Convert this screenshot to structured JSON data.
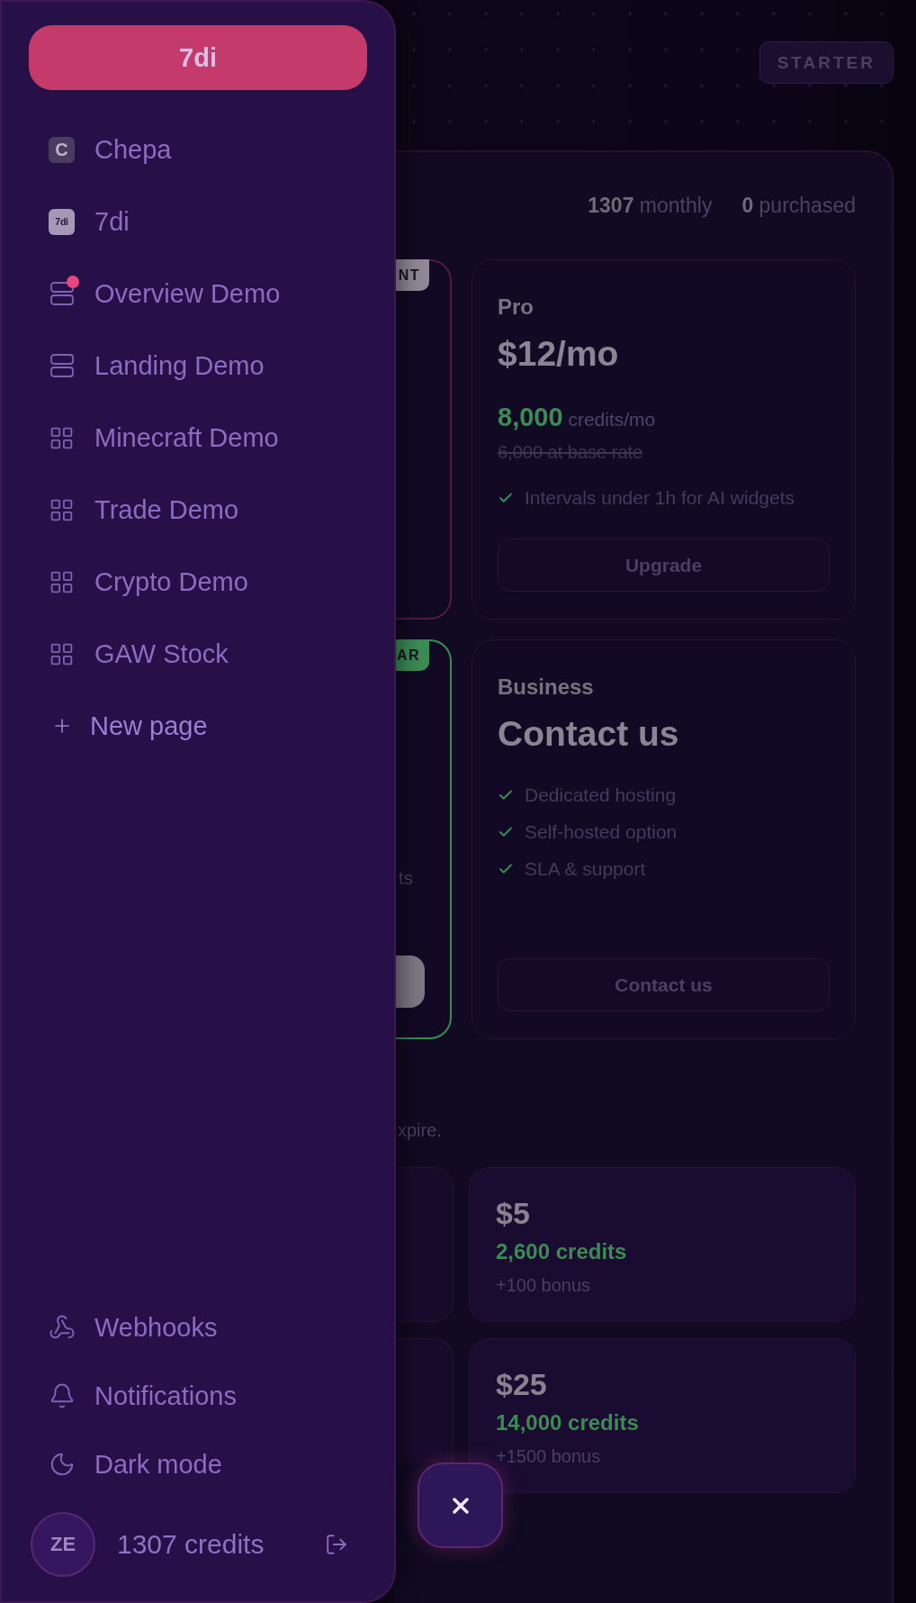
{
  "sidebar": {
    "workspace_button": "7di",
    "pages": [
      {
        "kind": "initial",
        "tile": "C",
        "label": "Chepa",
        "dot": false,
        "selected": false
      },
      {
        "kind": "tile",
        "tile": "7di",
        "label": "7di",
        "dot": false,
        "selected": false
      },
      {
        "kind": "rows",
        "label": "Overview Demo",
        "dot": true,
        "selected": false
      },
      {
        "kind": "rows",
        "label": "Landing Demo",
        "dot": false,
        "selected": false
      },
      {
        "kind": "grid",
        "label": "Minecraft Demo",
        "dot": false,
        "selected": false
      },
      {
        "kind": "grid",
        "label": "Trade Demo",
        "dot": false,
        "selected": false
      },
      {
        "kind": "grid",
        "label": "Crypto Demo",
        "dot": false,
        "selected": false
      },
      {
        "kind": "grid",
        "label": "GAW Stock",
        "dot": false,
        "selected": false
      }
    ],
    "new_page": "New page",
    "links": [
      {
        "kind": "webhook",
        "label": "Webhooks"
      },
      {
        "kind": "bell",
        "label": "Notifications"
      },
      {
        "kind": "moon",
        "label": "Dark mode"
      }
    ],
    "account": {
      "avatar": "ZE",
      "credits": "1307 credits"
    }
  },
  "header": {
    "plan_badge": "STARTER"
  },
  "credits_panel": {
    "stats": [
      "**1307** monthly",
      "**0** purchased"
    ],
    "plans": [
      {
        "kind": "covered",
        "badge": {
          "text": "NT",
          "color": "#8e8995"
        },
        "color": "#4e1c41",
        "button": false
      },
      {
        "kind": "plan",
        "name": "Pro",
        "price": "$12/mo",
        "credits": "**8,000** credits/mo",
        "base_rate": "6,000 at base rate",
        "features": [
          "Intervals under 1h for AI widgets"
        ],
        "button": "Upgrade"
      },
      {
        "kind": "covered",
        "badge": {
          "text": "AR",
          "color": "#3a8c55"
        },
        "color": "#3a8c55",
        "text": "ts",
        "button": true
      },
      {
        "kind": "plan",
        "name": "Business",
        "price": "Contact us",
        "features": [
          "Dedicated hosting",
          "Self-hosted option",
          "SLA & support"
        ],
        "button": "Contact us"
      }
    ],
    "note": "xpire.",
    "packs": [
      {
        "kind": "covered"
      },
      {
        "kind": "pack",
        "price": "$5",
        "credits": "2,600 credits",
        "bonus": "+100 bonus"
      },
      {
        "kind": "covered"
      },
      {
        "kind": "pack",
        "price": "$25",
        "credits": "14,000 credits",
        "bonus": "+1500 bonus"
      }
    ]
  }
}
